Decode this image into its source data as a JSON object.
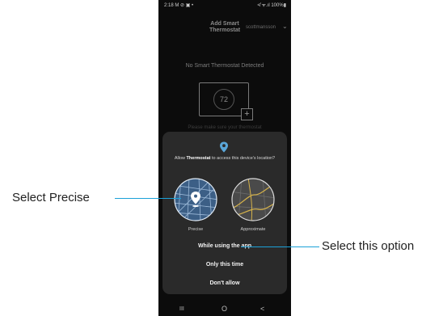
{
  "status_bar": {
    "time": "2:18",
    "icons": "M ⊘ ▣ •",
    "right": "≮ ᯤ.ıl 100%▮"
  },
  "header": {
    "title": "Add Smart Thermostat",
    "account": "scottmansson"
  },
  "main": {
    "empty_title": "No Smart Thermostat Detected",
    "temp": "72",
    "hint": "Please make sure your thermostat"
  },
  "dialog": {
    "prompt_prefix": "Allow ",
    "app_name": "Thermostat",
    "prompt_suffix": " to access this device's location?",
    "precise_label": "Precise",
    "approximate_label": "Approximate",
    "option_while_using": "While using the app",
    "option_only_this_time": "Only this time",
    "option_dont_allow": "Don't allow"
  },
  "nav": {
    "recents": "III",
    "home": "O",
    "back": "<"
  },
  "annotations": {
    "select_precise": "Select Precise",
    "select_option": "Select this option"
  },
  "colors": {
    "accent": "#5aa6d8",
    "callout_line": "#1ba1d8"
  }
}
